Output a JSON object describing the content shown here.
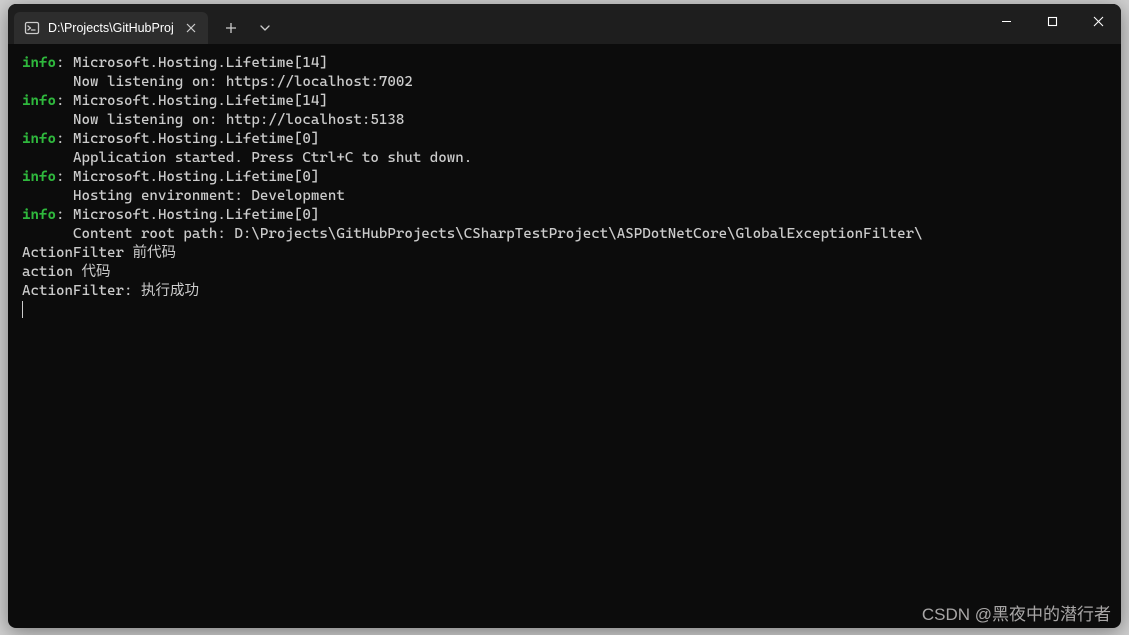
{
  "titlebar": {
    "tab_title": "D:\\Projects\\GitHubProj"
  },
  "terminal": {
    "entries": [
      {
        "level": "info",
        "source": "Microsoft.Hosting.Lifetime[14]",
        "detail": "Now listening on: https://localhost:7002"
      },
      {
        "level": "info",
        "source": "Microsoft.Hosting.Lifetime[14]",
        "detail": "Now listening on: http://localhost:5138"
      },
      {
        "level": "info",
        "source": "Microsoft.Hosting.Lifetime[0]",
        "detail": "Application started. Press Ctrl+C to shut down."
      },
      {
        "level": "info",
        "source": "Microsoft.Hosting.Lifetime[0]",
        "detail": "Hosting environment: Development"
      },
      {
        "level": "info",
        "source": "Microsoft.Hosting.Lifetime[0]",
        "detail": "Content root path: D:\\Projects\\GitHubProjects\\CSharpTestProject\\ASPDotNetCore\\GlobalExceptionFilter\\"
      }
    ],
    "plain_lines": [
      "ActionFilter 前代码",
      "action 代码",
      "ActionFilter: 执行成功"
    ]
  },
  "watermark": "CSDN @黑夜中的潜行者"
}
